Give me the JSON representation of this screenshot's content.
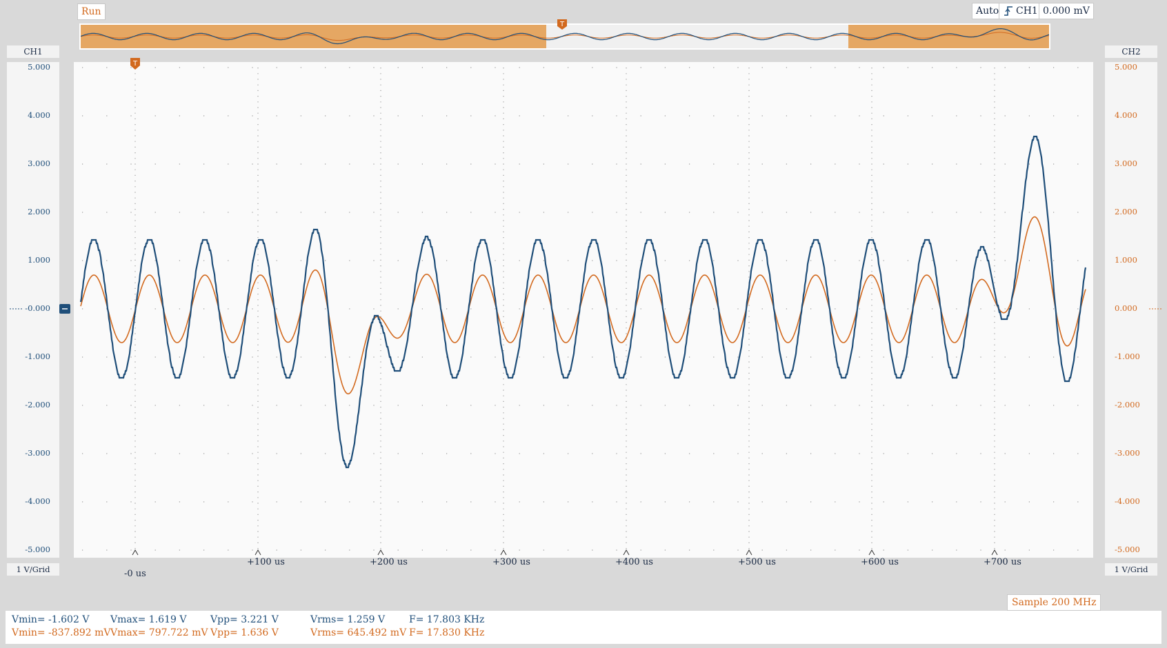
{
  "top_bar": {
    "run_label": "Run",
    "trigger_mode": "Auto",
    "trigger_source": "CH1",
    "trigger_level": "0.000 mV",
    "trigger_marker": "T"
  },
  "channels": {
    "ch1": {
      "label": "CH1",
      "scale": "1 V/Grid",
      "color": "#1f4e79",
      "offset_label": "-0.000"
    },
    "ch2": {
      "label": "CH2",
      "scale": "1 V/Grid",
      "color": "#d2691e",
      "offset_label": "0.000"
    }
  },
  "y_ticks_left": [
    "5.000",
    "4.000",
    "3.000",
    "2.000",
    "1.000",
    "-0.000",
    "-1.000",
    "-2.000",
    "-3.000",
    "-4.000",
    "-5.000"
  ],
  "y_ticks_right": [
    "5.000",
    "4.000",
    "3.000",
    "2.000",
    "1.000",
    "0.000",
    "-1.000",
    "-2.000",
    "-3.000",
    "-4.000",
    "-5.000"
  ],
  "x_ticks": [
    "-0 us",
    "+100 us",
    "+200 us",
    "+300 us",
    "+400 us",
    "+500 us",
    "+600 us",
    "+700 us"
  ],
  "sample_rate": "Sample 200 MHz",
  "measurements": {
    "ch1": {
      "vmin": "Vmin= -1.602 V",
      "vmax": "Vmax= 1.619 V",
      "vpp": "Vpp= 3.221 V",
      "vrms": "Vrms= 1.259 V",
      "freq": "F= 17.803 KHz"
    },
    "ch2": {
      "vmin": "Vmin= -837.892 mV",
      "vmax": "Vmax= 797.722 mV",
      "vpp": "Vpp= 1.636 V",
      "vrms": "Vrms= 645.492 mV",
      "freq": "F= 17.830 KHz"
    }
  },
  "colors": {
    "ch1": "#1f4e79",
    "ch2": "#d2691e",
    "overview_band": "#e5a763",
    "background": "#d9d9d9"
  }
}
